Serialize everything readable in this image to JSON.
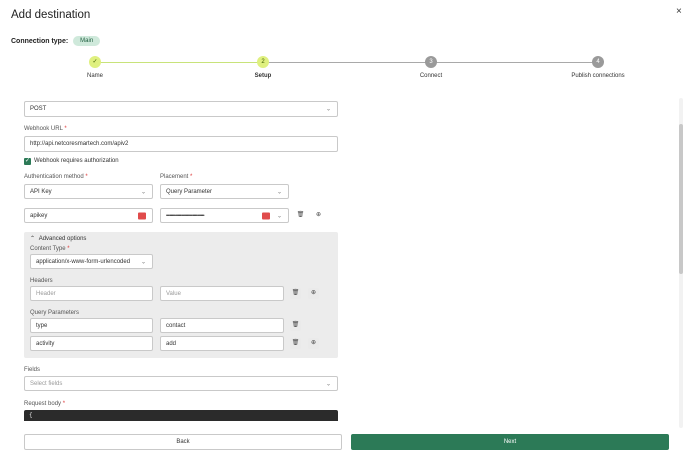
{
  "dialog": {
    "title": "Add destination",
    "close_glyph": "×"
  },
  "connection": {
    "label": "Connection type:",
    "badge": "Main"
  },
  "stepper": {
    "steps": [
      {
        "label": "Name",
        "marker": "✓",
        "state": "done"
      },
      {
        "label": "Setup",
        "marker": "2",
        "state": "active"
      },
      {
        "label": "Connect",
        "marker": "3",
        "state": "todo"
      },
      {
        "label": "Publish connections",
        "marker": "4",
        "state": "todo"
      }
    ]
  },
  "form": {
    "method": {
      "value": "POST"
    },
    "webhook_url": {
      "label": "Webhook URL",
      "required": "*",
      "value": "http://api.netcoresmartech.com/apiv2"
    },
    "auth_checkbox": {
      "label": "Webhook requires authorization",
      "checked_glyph": "✓"
    },
    "auth_method": {
      "label": "Authentication method",
      "required": "*",
      "value": "API Key"
    },
    "placement": {
      "label": "Placement",
      "required": "*",
      "value": "Query Parameter"
    },
    "api_key_name": {
      "value": "apikey"
    },
    "api_key_value": {
      "value": "•••••••••••••••••••••••••••••••••"
    },
    "advanced": {
      "title": "Advanced options",
      "content_type": {
        "label": "Content Type",
        "required": "*",
        "value": "application/x-www-form-urlencoded"
      },
      "headers": {
        "label": "Headers",
        "key_placeholder": "Header",
        "value_placeholder": "Value"
      },
      "query_params": {
        "label": "Query Parameters",
        "rows": [
          {
            "key": "type",
            "value": "contact"
          },
          {
            "key": "activity",
            "value": "add"
          }
        ]
      }
    },
    "fields": {
      "label": "Fields",
      "placeholder": "Select fields"
    },
    "request_body": {
      "label": "Request body",
      "required": "*",
      "first_line": "{"
    }
  },
  "buttons": {
    "back": "Back",
    "next": "Next"
  },
  "icons": {
    "chevron": "⌄",
    "delete": "🗑",
    "add": "⊕",
    "collapse": "⌃"
  },
  "colors": {
    "accent": "#2c7a57",
    "step_done": "#dff07f",
    "warning": "#e04b4b"
  }
}
